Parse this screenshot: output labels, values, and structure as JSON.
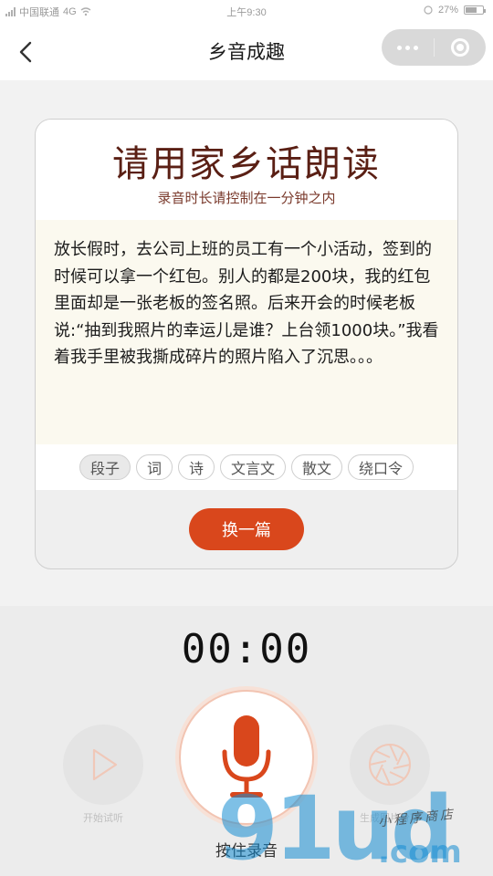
{
  "status_bar": {
    "carrier": "中国联通",
    "network": "4G",
    "time": "上午9:30",
    "battery": "27%"
  },
  "nav": {
    "title": "乡音成趣"
  },
  "card": {
    "title": "请用家乡话朗读",
    "subtitle": "录音时长请控制在一分钟之内",
    "passage": "放长假时，去公司上班的员工有一个小活动，签到的时候可以拿一个红包。别人的都是200块，我的红包里面却是一张老板的签名照。后来开会的时候老板说:“抽到我照片的幸运儿是谁？上台领1000块。”我看着我手里被我撕成碎片的照片陷入了沉思。。。",
    "tags": [
      "段子",
      "词",
      "诗",
      "文言文",
      "散文",
      "绕口令"
    ],
    "active_tag_index": 0,
    "swap_button": "换一篇"
  },
  "recorder": {
    "timer": "00:00",
    "preview_label": "开始试听",
    "share_label": "生成图片分享",
    "hold_label": "按住录音"
  },
  "colors": {
    "accent": "#d9471c",
    "title": "#5a1f14"
  },
  "watermark": {
    "main": "91ud",
    "suffix": ".com",
    "script": "小程序商店"
  }
}
